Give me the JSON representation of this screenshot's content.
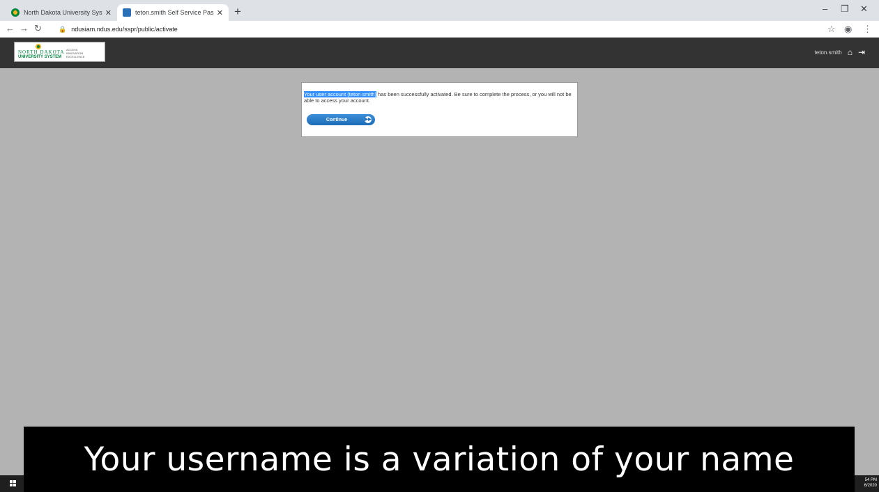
{
  "browser": {
    "tabs": [
      {
        "title": "North Dakota University System",
        "icon": "ndus-favicon",
        "active": false
      },
      {
        "title": "teton.smith Self Service Passwor",
        "icon": "sspr-favicon",
        "active": true
      }
    ],
    "new_tab_label": "+",
    "url": "ndusiam.ndus.edu/sspr/public/activate"
  },
  "header": {
    "logo_line1": "NORTH DAKOTA",
    "logo_line2": "UNIVERSITY SYSTEM",
    "logo_tagline": "ACCESS INNOVATION EXCELLENCE",
    "username": "teton.smith"
  },
  "message": {
    "highlighted": "Your user account (teton smith)",
    "rest": " has been successfully activated. Be sure to complete the process, or you will not be able to access your account.",
    "button_label": "Continue"
  },
  "taskbar": {
    "time": "54 PM",
    "date": "6/2020"
  },
  "caption": {
    "text": "Your username is a variation of your name"
  },
  "colors": {
    "page_bg": "#b3b3b3",
    "header_bg": "#333333",
    "accent_blue": "#1c6cb8",
    "highlight": "#3390ff"
  }
}
